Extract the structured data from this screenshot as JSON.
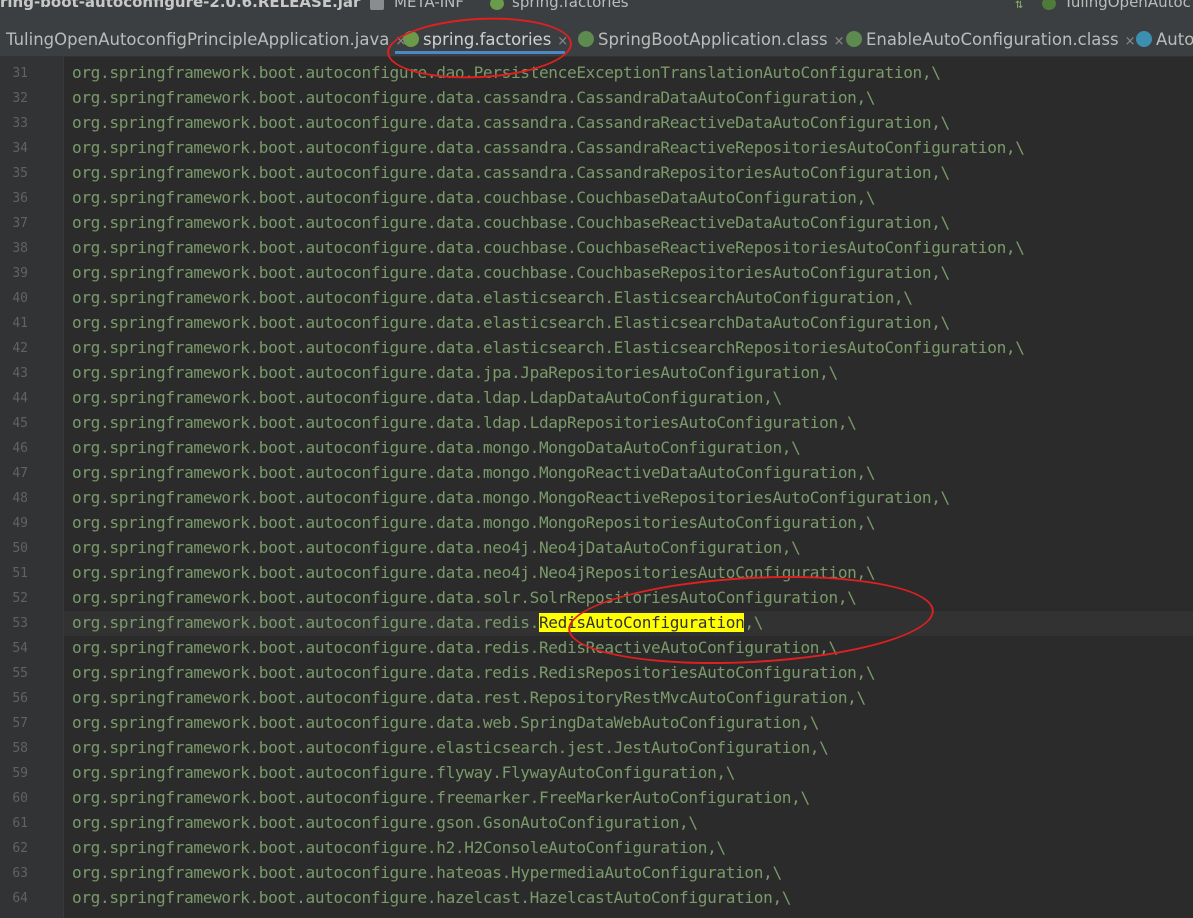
{
  "breadcrumb": {
    "jar": "ring-boot-autoconfigure-2.0.6.RELEASE.jar",
    "folder": "META-INF",
    "file": "spring.factories",
    "run_config": "TulingOpenAutoc"
  },
  "tabs": [
    {
      "label": "TulingOpenAutoconfigPrincipleApplication.java",
      "close": "×"
    },
    {
      "label": "spring.factories",
      "close": "×"
    },
    {
      "label": "SpringBootApplication.class",
      "close": "×"
    },
    {
      "label": "EnableAutoConfiguration.class",
      "close": "×"
    },
    {
      "label": "Auto",
      "close": ""
    }
  ],
  "editor": {
    "line_numbers": [
      "31",
      "32",
      "33",
      "34",
      "35",
      "36",
      "37",
      "38",
      "39",
      "40",
      "41",
      "42",
      "43",
      "44",
      "45",
      "46",
      "47",
      "48",
      "49",
      "50",
      "51",
      "52",
      "53",
      "54",
      "55",
      "56",
      "57",
      "58",
      "59",
      "60",
      "61",
      "62",
      "63",
      "64"
    ],
    "highlight_pre": "org.springframework.boot.autoconfigure.data.redis.",
    "highlight_word": "RedisAutoConfiguration",
    "highlight_post": ",\\",
    "lines": [
      "org.springframework.boot.autoconfigure.dao.PersistenceExceptionTranslationAutoConfiguration,\\",
      "org.springframework.boot.autoconfigure.data.cassandra.CassandraDataAutoConfiguration,\\",
      "org.springframework.boot.autoconfigure.data.cassandra.CassandraReactiveDataAutoConfiguration,\\",
      "org.springframework.boot.autoconfigure.data.cassandra.CassandraReactiveRepositoriesAutoConfiguration,\\",
      "org.springframework.boot.autoconfigure.data.cassandra.CassandraRepositoriesAutoConfiguration,\\",
      "org.springframework.boot.autoconfigure.data.couchbase.CouchbaseDataAutoConfiguration,\\",
      "org.springframework.boot.autoconfigure.data.couchbase.CouchbaseReactiveDataAutoConfiguration,\\",
      "org.springframework.boot.autoconfigure.data.couchbase.CouchbaseReactiveRepositoriesAutoConfiguration,\\",
      "org.springframework.boot.autoconfigure.data.couchbase.CouchbaseRepositoriesAutoConfiguration,\\",
      "org.springframework.boot.autoconfigure.data.elasticsearch.ElasticsearchAutoConfiguration,\\",
      "org.springframework.boot.autoconfigure.data.elasticsearch.ElasticsearchDataAutoConfiguration,\\",
      "org.springframework.boot.autoconfigure.data.elasticsearch.ElasticsearchRepositoriesAutoConfiguration,\\",
      "org.springframework.boot.autoconfigure.data.jpa.JpaRepositoriesAutoConfiguration,\\",
      "org.springframework.boot.autoconfigure.data.ldap.LdapDataAutoConfiguration,\\",
      "org.springframework.boot.autoconfigure.data.ldap.LdapRepositoriesAutoConfiguration,\\",
      "org.springframework.boot.autoconfigure.data.mongo.MongoDataAutoConfiguration,\\",
      "org.springframework.boot.autoconfigure.data.mongo.MongoReactiveDataAutoConfiguration,\\",
      "org.springframework.boot.autoconfigure.data.mongo.MongoReactiveRepositoriesAutoConfiguration,\\",
      "org.springframework.boot.autoconfigure.data.mongo.MongoRepositoriesAutoConfiguration,\\",
      "org.springframework.boot.autoconfigure.data.neo4j.Neo4jDataAutoConfiguration,\\",
      "org.springframework.boot.autoconfigure.data.neo4j.Neo4jRepositoriesAutoConfiguration,\\",
      "org.springframework.boot.autoconfigure.data.solr.SolrRepositoriesAutoConfiguration,\\",
      "",
      "org.springframework.boot.autoconfigure.data.redis.RedisReactiveAutoConfiguration,\\",
      "org.springframework.boot.autoconfigure.data.redis.RedisRepositoriesAutoConfiguration,\\",
      "org.springframework.boot.autoconfigure.data.rest.RepositoryRestMvcAutoConfiguration,\\",
      "org.springframework.boot.autoconfigure.data.web.SpringDataWebAutoConfiguration,\\",
      "org.springframework.boot.autoconfigure.elasticsearch.jest.JestAutoConfiguration,\\",
      "org.springframework.boot.autoconfigure.flyway.FlywayAutoConfiguration,\\",
      "org.springframework.boot.autoconfigure.freemarker.FreeMarkerAutoConfiguration,\\",
      "org.springframework.boot.autoconfigure.gson.GsonAutoConfiguration,\\",
      "org.springframework.boot.autoconfigure.h2.H2ConsoleAutoConfiguration,\\",
      "org.springframework.boot.autoconfigure.hateoas.HypermediaAutoConfiguration,\\",
      "org.springframework.boot.autoconfigure.hazelcast.HazelcastAutoConfiguration,\\"
    ]
  },
  "colors": {
    "code_text": "#7a9a6a",
    "highlight": "#ffff00",
    "annotation": "#e02020",
    "active_tab_underline": "#4a88c7"
  }
}
